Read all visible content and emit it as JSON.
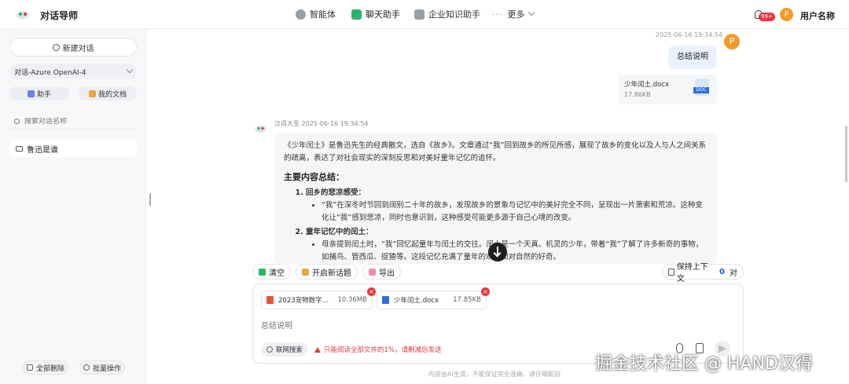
{
  "app": {
    "title": "对话导师"
  },
  "nav": {
    "tabs": [
      {
        "label": "智能体",
        "icon": "agent-icon"
      },
      {
        "label": "聊天助手",
        "icon": "chat-assistant-icon",
        "active": true
      },
      {
        "label": "企业知识助手",
        "icon": "knowledge-icon"
      },
      {
        "label": "更多",
        "icon": "more-dots-icon"
      }
    ]
  },
  "header": {
    "notification_count": "99+",
    "avatar_letter": "P",
    "username": "用户名称"
  },
  "sidebar": {
    "new_chat": "新建对话",
    "model": "对话-Azure OpenAI-4",
    "assistant_btn": "助手",
    "docs_btn": "我的文档",
    "search_placeholder": "搜索对话名称",
    "history": [
      {
        "label": "鲁迅是谁"
      }
    ],
    "delete_all": "全部删除",
    "batch": "批量操作"
  },
  "chat": {
    "user_message": {
      "timestamp": "2025-06-16 19:34:54",
      "avatar": "P",
      "text": "总结说明",
      "file": {
        "name": "少年闰土.docx",
        "size": "17.86KB",
        "type": "DOC"
      }
    },
    "bot_message": {
      "meta": "汉得大圣 2025-06-16 19:34:54",
      "intro": "《少年闰土》是鲁迅先生的经典散文，选自《故乡》。文章通过“我”回到故乡的所见所感，展现了故乡的变化以及人与人之间关系的疏离，表达了对社会现实的深刻反思和对美好童年记忆的追怀。",
      "heading": "主要内容总结：",
      "items": [
        {
          "title": "回乡的悲凉感受：",
          "bullet": "“我”在深冬时节回到阔别二十年的故乡，发现故乡的景象与记忆中的美好完全不同，呈现出一片萧索和荒凉。这种变化让“我”感到悲凉，同时也意识到，这种感受可能更多源于自己心境的改变。"
        },
        {
          "title": "童年记忆中的闰土：",
          "bullet": "母亲提到闰土时，“我”回忆起童年与闰土的交往。闰土是一个天真、机灵的少年，带着“我”了解了许多新奇的事物，如捕鸟、管西瓜、捉猹等。这段记忆充满了童年的欢乐和对自然的好奇。"
        }
      ]
    }
  },
  "actions": {
    "clear": "清空",
    "new_topic": "开启新话题",
    "export": "导出",
    "keep_context": "保持上下文",
    "context_count": "0",
    "context_unit": "对"
  },
  "composer": {
    "attachments": [
      {
        "name": "2023宠物数字…",
        "size": "10.36MB",
        "type": "pdf"
      },
      {
        "name": "少年闰土.docx",
        "size": "17.85KB",
        "type": "doc"
      }
    ],
    "placeholder": "总结说明",
    "web_search": "联网搜索",
    "warning": "只能阅读全部文件的1%，请删减后发送"
  },
  "footer": {
    "disclaimer": "内容由AI生成，不能保证完全准确，请仔细甄别",
    "watermark": "掘金技术社区 @ HAND汉得"
  },
  "colors": {
    "accent_green": "#2ab56b",
    "brand_orange": "#f39a2b",
    "warning_red": "#e03b3b",
    "link_blue": "#1e5bd8"
  }
}
